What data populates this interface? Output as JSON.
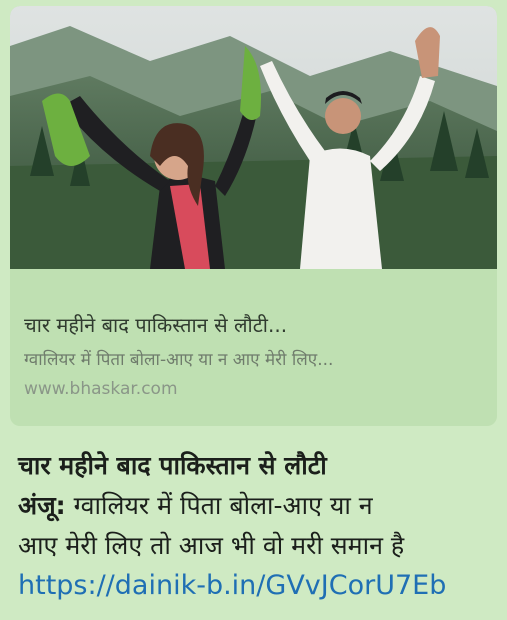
{
  "link_preview": {
    "title": "चार महीने बाद पाकिस्तान से लौटी...",
    "description": "ग्वालियर में पिता बोला-आए या न आए मेरी लिए...",
    "domain": "www.bhaskar.com"
  },
  "message": {
    "headline": "चार महीने बाद पाकिस्तान से लौटी",
    "lead_bold": "अंजू:",
    "line2_rest": " ग्वालियर में पिता बोला-आए या न",
    "line3": "आए मेरी लिए तो आज भी वो मरी समान है",
    "link": "https://dainik-b.in/GVvJCorU7Eb"
  }
}
